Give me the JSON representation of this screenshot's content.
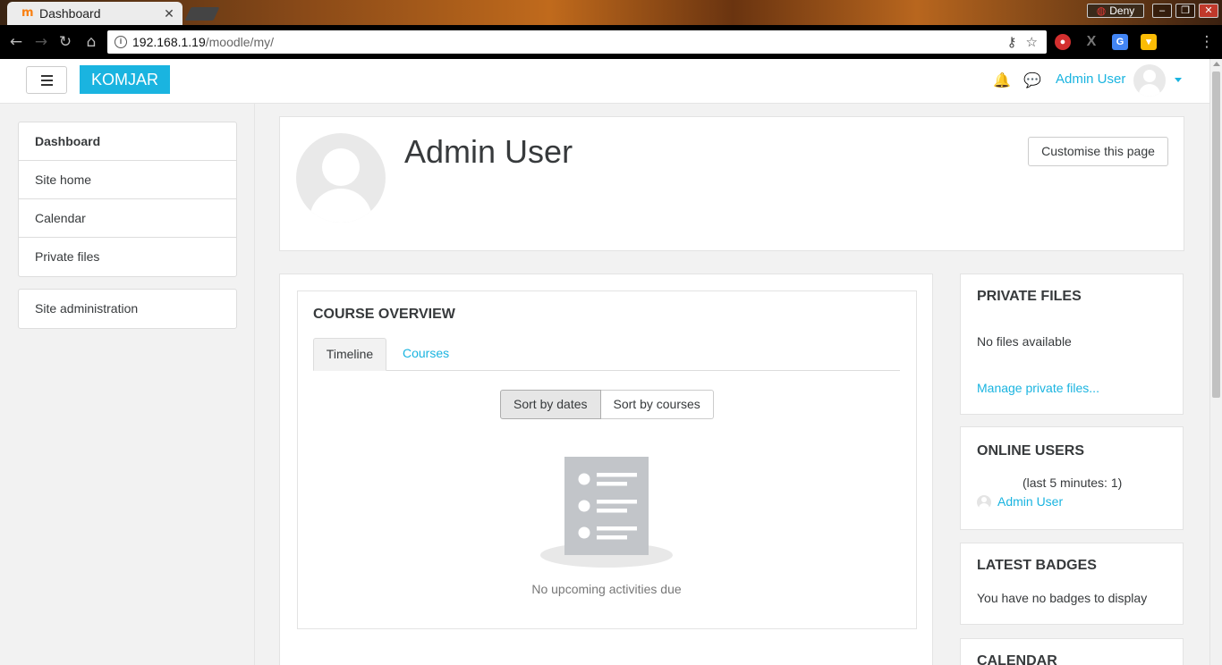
{
  "browser": {
    "tab_title": "Dashboard",
    "tab_favicon": "m",
    "deny_label": "Deny",
    "url_host": "192.168.1.19",
    "url_path": "/moodle/my/"
  },
  "navbar": {
    "brand": "KOMJAR",
    "user_name": "Admin User"
  },
  "drawer": {
    "items": [
      {
        "label": "Dashboard"
      },
      {
        "label": "Site home"
      },
      {
        "label": "Calendar"
      },
      {
        "label": "Private files"
      }
    ],
    "admin_item": "Site administration"
  },
  "header": {
    "title": "Admin User",
    "customise_button": "Customise this page"
  },
  "course_overview": {
    "title": "COURSE OVERVIEW",
    "tabs": [
      {
        "label": "Timeline"
      },
      {
        "label": "Courses"
      }
    ],
    "sort_buttons": [
      {
        "label": "Sort by dates"
      },
      {
        "label": "Sort by courses"
      }
    ],
    "empty_message": "No upcoming activities due"
  },
  "blocks": {
    "private_files": {
      "title": "PRIVATE FILES",
      "empty_text": "No files available",
      "manage_link": "Manage private files..."
    },
    "online_users": {
      "title": "ONLINE USERS",
      "summary": "(last 5 minutes: 1)",
      "user": "Admin User"
    },
    "latest_badges": {
      "title": "LATEST BADGES",
      "empty_text": "You have no badges to display"
    },
    "calendar": {
      "title": "CALENDAR"
    }
  },
  "colors": {
    "brand": "#1ab4e0",
    "link": "#1ab4e0",
    "page_bg": "#f2f2f2"
  }
}
